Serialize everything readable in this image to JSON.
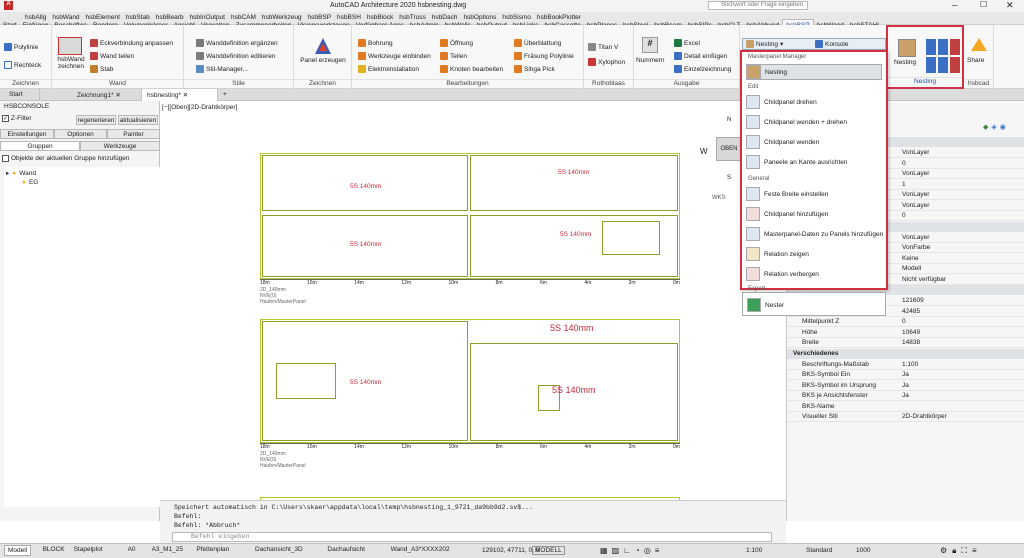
{
  "window": {
    "title": "AutoCAD Architecture 2020    hsbnesting.dwg",
    "search_placeholder": "Stichwort oder Frage eingeben"
  },
  "ribbon_tabs": [
    "hsbAllg",
    "hsbWand",
    "hsbElement",
    "hsbStab",
    "hsbBearb",
    "hsbInOutput",
    "hsbCAM",
    "hsbWerkzeug",
    "hsbBSP",
    "hsbBSH",
    "hsbBlock",
    "hsbTruss",
    "hsbDach",
    "hsbOptions",
    "hsbSismo",
    "hsbBookPlotter"
  ],
  "ribbon_tabs2": [
    "Start",
    "Einfügen",
    "Beschriften",
    "Rendern",
    "Volumenkörper",
    "Ansicht",
    "Verwalten",
    "Zusammenarbeiten",
    "Visionswerkzeuge",
    "Verfügbare Apps",
    "hsbAdmin",
    "hsbWalls",
    "hsbOutput",
    "hsbLinks",
    "hsbCassette",
    "hsbPlanes",
    "hsbSteel",
    "hsbBeam",
    "hsbSIPs",
    "hsbCLT",
    "hsbAbbund",
    "hsbBSP",
    "hsbWand",
    "hsbSTAHL"
  ],
  "ribbon": {
    "zeichnen1": {
      "polylinie": "Polylinie",
      "rechteck": "Rechteck",
      "title": "Zeichnen"
    },
    "wand": {
      "hsbwand": "hsbWand zeichnen",
      "eckverbindung": "Eckverbindung anpassen",
      "wand_teilen": "Wand teilen",
      "stab": "Stab",
      "title": "Wand"
    },
    "stile": {
      "wanddef_erg": "Wanddefinition ergänzen",
      "wanddef_edit": "Wanddefinition editieren",
      "stil_manager": "Stil-Manager...",
      "title": "Stile"
    },
    "zeichnen2": {
      "panel_erzeugen": "Panel erzeugen",
      "title": "Zeichnen"
    },
    "bearbeitung": {
      "bohrung": "Bohrung",
      "werkzeuge": "Werkzeuge einbinden",
      "elektro": "Elektroinstallation",
      "oeffnung": "Öffnung",
      "teilen": "Teilen",
      "knoten": "Knoten bearbeiten",
      "ueberblattung": "Überblattung",
      "fraesung": "Fräsung Polylinie",
      "sihga": "Sihga Pick",
      "title": "Bearbeitungen"
    },
    "rothoblaas": {
      "titan": "Titan V",
      "xylophon": "Xylophon",
      "title": "Rothoblaas"
    },
    "ausgabe": {
      "nummern": "Nummern",
      "excel": "Excel",
      "detail": "Detail einfügen",
      "einzelzeichnung": "Einzelzeichnung",
      "title": "Ausgabe"
    },
    "nesting": {
      "nesting_btn": "Nesting",
      "konsole": "Konsole",
      "nesting_big": "Nesting",
      "title": "Nesting",
      "share": "Share",
      "hsbcad": "hsbcad"
    }
  },
  "doc_tabs": [
    "Start",
    "Zeichnung1*",
    "hsbnesting*"
  ],
  "left_panel": {
    "title": "HSBCONSOLE",
    "zfilter": "Z-Filter",
    "regenerieren": "regenerieren",
    "aktualisieren": "aktualisieren",
    "tabs1": [
      "Einstellungen",
      "Optionen",
      "Painter"
    ],
    "tabs2": [
      "Gruppen",
      "Werkzeuge"
    ],
    "add_objects": "Objekte der aktuellen Gruppe hinzufügen",
    "tree": [
      "Wand",
      "EG"
    ]
  },
  "canvas": {
    "viewport_label": "[−][Oben][2D-Drahtkörper]",
    "viewcube": {
      "top": "N",
      "right": "O",
      "bottom": "S",
      "left": "W",
      "center": "OBEN"
    },
    "wks": "WKS",
    "panel_label": "5S 140mm",
    "panel_small": "2D_140mm",
    "panel_sub": "NVE(0)",
    "panel_master": "Haufen/MasterPanel",
    "ruler_top": [
      "18m",
      "16m",
      "14m",
      "12m",
      "10m",
      "8m",
      "6m",
      "4m",
      "2m",
      "0m"
    ],
    "ruler_bottom": [
      "18m",
      "16m",
      "14m",
      "12m",
      "10m",
      "8m",
      "6m",
      "4m",
      "2m",
      "0m"
    ]
  },
  "dropdown": {
    "header": "Nesting",
    "konsole": "Konsole",
    "section_master": "Masterpanel Manager",
    "nesting_item": "Nesting",
    "section_edit": "Edit",
    "items_edit": [
      "Childpanel drehen",
      "Childpanel wenden + drehen",
      "Childpanel wenden",
      "Paneele an Kante ausrichten"
    ],
    "section_general": "General",
    "items_general": [
      "Feste Breite einstellen",
      "Childpanel hinzufügen",
      "Masterpanel-Daten zu Panels hinzufügen",
      "Relation zeigen",
      "Relation verbergen"
    ],
    "section_export": "Export",
    "items_export": [
      "Nester"
    ]
  },
  "properties": {
    "rows_top": [
      {
        "k": "",
        "v": "VonLayer"
      },
      {
        "k": "",
        "v": "0"
      },
      {
        "k": "",
        "v": "VonLayer"
      },
      {
        "k": "",
        "v": "1"
      },
      {
        "k": "",
        "v": "VonLayer"
      },
      {
        "k": "",
        "v": "VonLayer"
      },
      {
        "k": "",
        "v": "0"
      }
    ],
    "rows_mid": [
      {
        "k": "",
        "v": "VonLayer"
      },
      {
        "k": "",
        "v": "VonFarbe"
      },
      {
        "k": "",
        "v": "Keine"
      },
      {
        "k": "",
        "v": "Modell"
      },
      {
        "k": "",
        "v": "Nicht verfügbar"
      }
    ],
    "rows_coords": [
      {
        "k": "",
        "v": "121609"
      },
      {
        "k": "Mittelpunkt Y",
        "v": "42485"
      },
      {
        "k": "Mittelpunkt Z",
        "v": "0"
      },
      {
        "k": "Höhe",
        "v": "10649"
      },
      {
        "k": "Breite",
        "v": "14838"
      }
    ],
    "section_misc": "Verschiedenes",
    "rows_misc": [
      {
        "k": "Beschriftungs-Maßstab",
        "v": "1:100"
      },
      {
        "k": "BKS-Symbol Ein",
        "v": "Ja"
      },
      {
        "k": "BKS-Symbol im Ursprung",
        "v": "Ja"
      },
      {
        "k": "BKS je Ansichtsfenster",
        "v": "Ja"
      },
      {
        "k": "BKS-Name",
        "v": ""
      },
      {
        "k": "Visueller Stil",
        "v": "2D-Drahtkörper"
      }
    ]
  },
  "command": {
    "line1": "Speichert automatisch in C:\\Users\\skaer\\appdata\\local\\temp\\hsbnesting_1_9721_da9bb9d2.sv$...",
    "line2": "Befehl:",
    "line3": "Befehl: *Abbruch*",
    "placeholder": "Befehl eingeben"
  },
  "status": {
    "tabs": [
      "Modell",
      "BLOCK",
      "Stapelplot",
      "A0",
      "A3_M1_25",
      "Pfettenplan",
      "Dachansicht_3D",
      "Dachaufsicht",
      "Wand_A3*XXXX202"
    ],
    "coords": "129102, 47711, 0, 0",
    "mode": "MODELL",
    "scale": "1:100",
    "standard": "Standard",
    "zoom": "1000"
  }
}
